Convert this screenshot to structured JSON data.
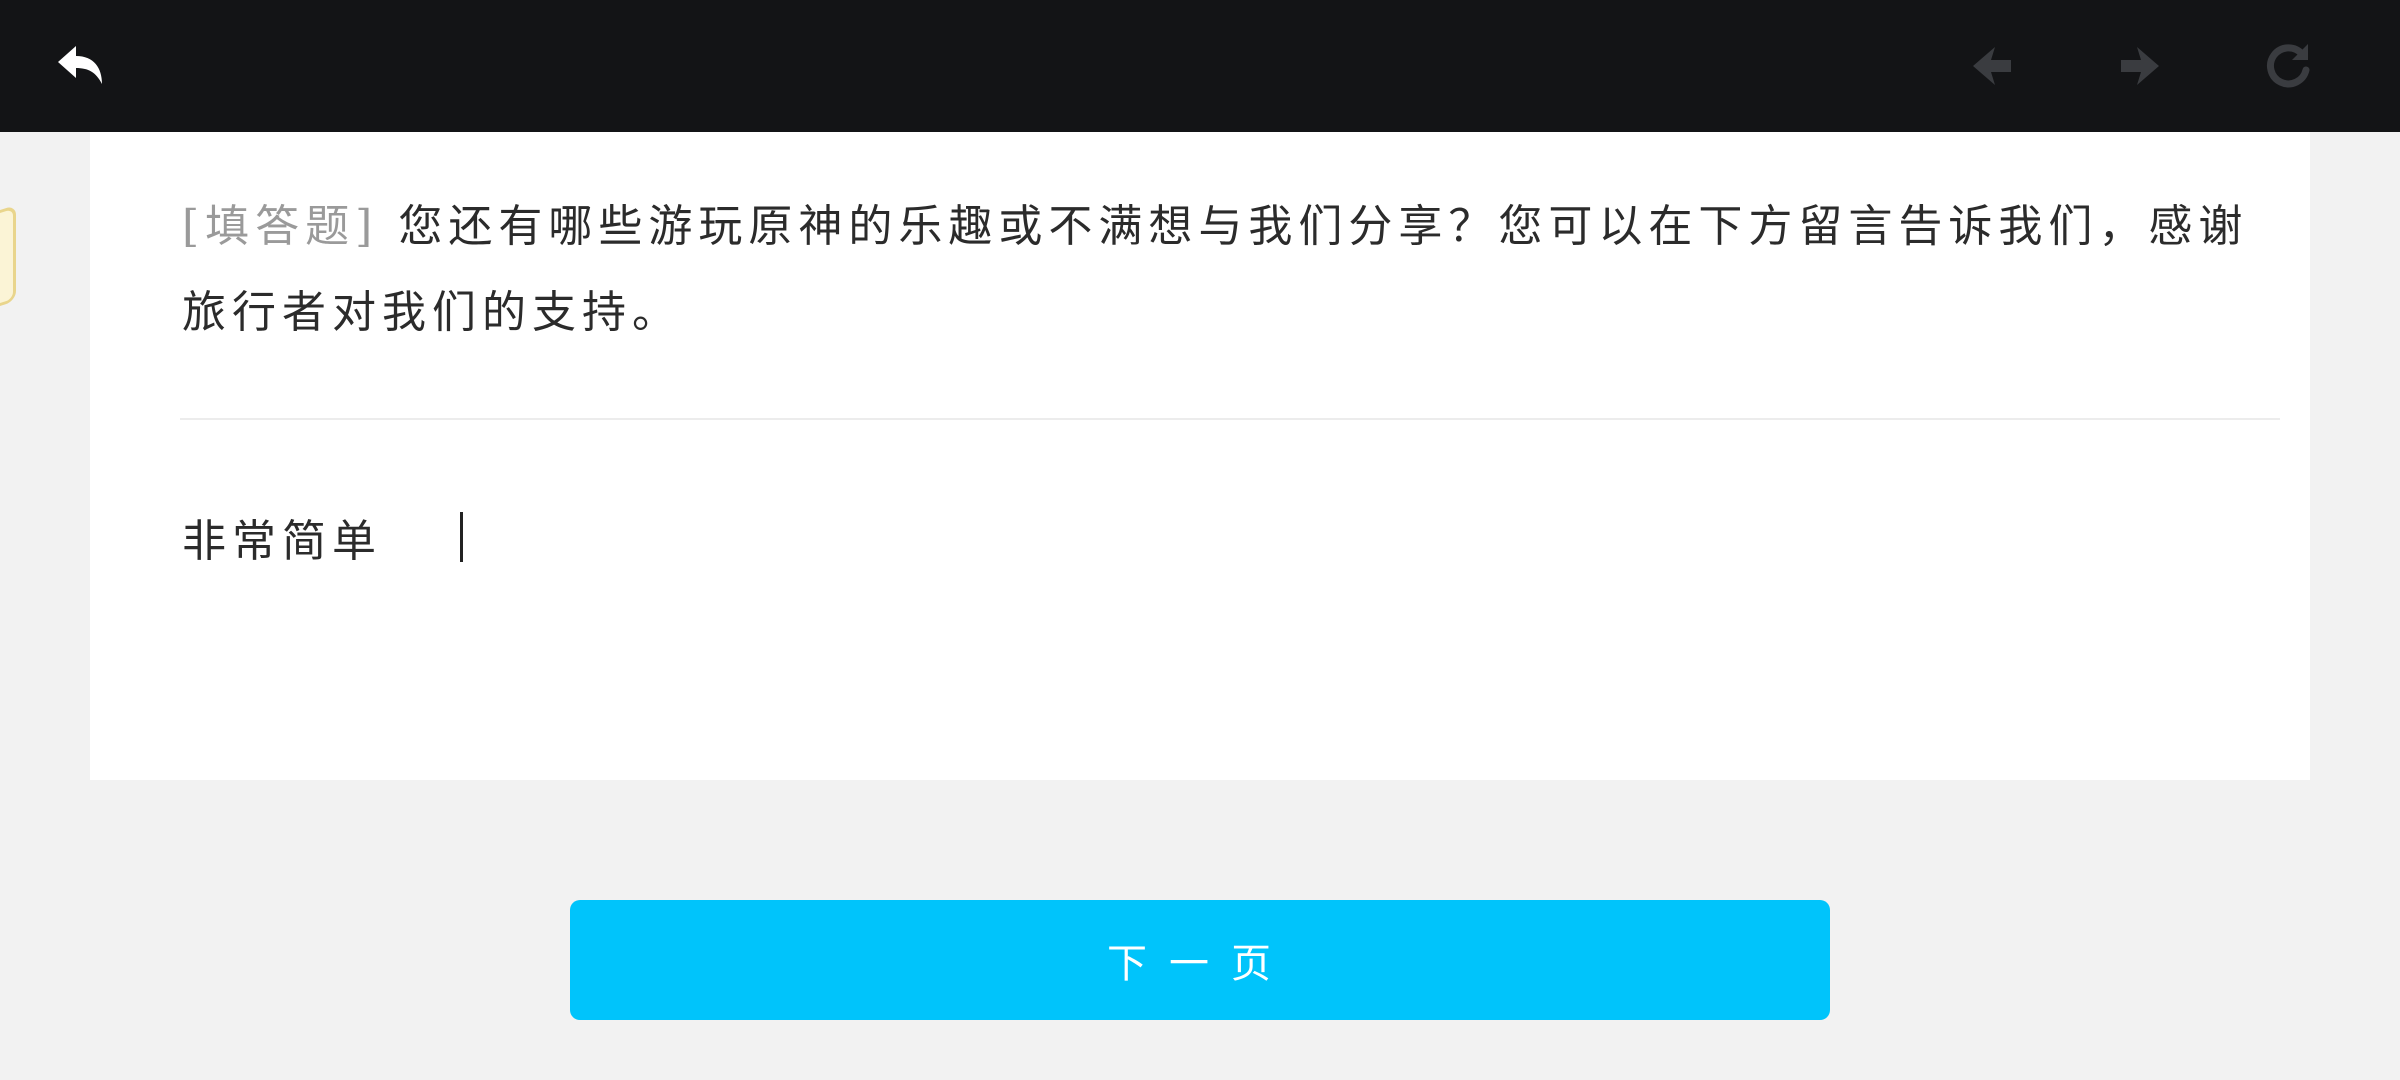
{
  "toolbar": {
    "back_icon": "back-arrow-icon",
    "prev_icon": "prev-arrow-icon",
    "next_icon": "next-arrow-icon",
    "reload_icon": "reload-icon"
  },
  "question": {
    "tag": "[填答题]",
    "text": "您还有哪些游玩原神的乐趣或不满想与我们分享？您可以在下方留言告诉我们，感谢旅行者对我们的支持。"
  },
  "answer": {
    "value": "非常简单"
  },
  "next_button": {
    "label": "下一页"
  },
  "colors": {
    "topbar": "#131416",
    "accent": "#00c4fb",
    "background": "#f2f2f2",
    "card": "#ffffff"
  }
}
